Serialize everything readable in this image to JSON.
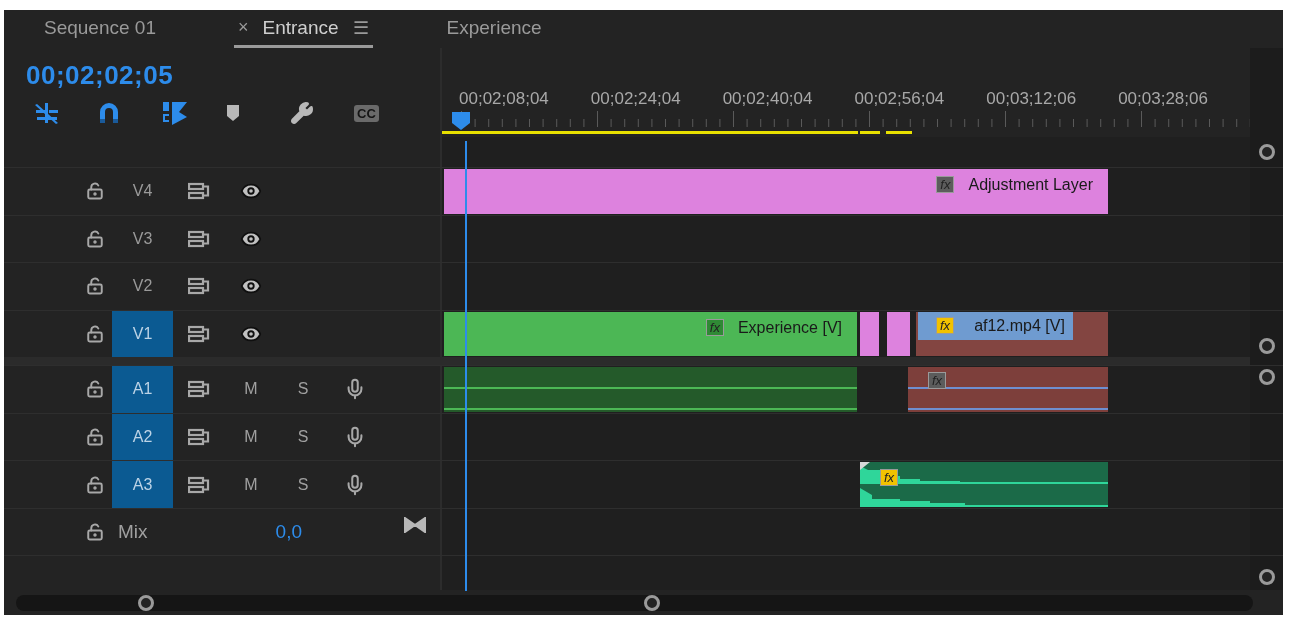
{
  "tabs": [
    {
      "label": "Sequence 01",
      "selected": false
    },
    {
      "label": "Entrance",
      "selected": true,
      "close": "×",
      "menu": "☰"
    },
    {
      "label": "Experience",
      "selected": false
    }
  ],
  "timecode": "00;02;02;05",
  "toolbar": {
    "cc_label": "CC"
  },
  "ruler": {
    "labels": [
      "00;02;08;04",
      "00;02;24;04",
      "00;02;40;04",
      "00;02;56;04",
      "00;03;12;06",
      "00;03;28;06"
    ]
  },
  "tracks": [
    {
      "name": "V4",
      "kind": "video",
      "targeted": false,
      "clips": [
        {
          "kind": "video",
          "label": "Adjustment Layer",
          "color": "#dd82de",
          "fx": {
            "label": "fx",
            "color": "#5c5c5c"
          }
        }
      ]
    },
    {
      "name": "V3",
      "kind": "video",
      "targeted": false
    },
    {
      "name": "V2",
      "kind": "video",
      "targeted": false
    },
    {
      "name": "V1",
      "kind": "video",
      "targeted": true,
      "clips": [
        {
          "kind": "video",
          "label": "Experience [V]",
          "color": "#4cb755",
          "fx": {
            "label": "fx",
            "color": "#2f8a35"
          }
        },
        {
          "kind": "plain",
          "color": "#dd82de"
        },
        {
          "kind": "plain",
          "color": "#dd82de"
        },
        {
          "kind": "header",
          "label": "af12.mp4 [V]",
          "color": "#834541",
          "fx": {
            "label": "fx",
            "color": "#f2c200"
          }
        }
      ]
    },
    {
      "name": "A1",
      "kind": "audio",
      "targeted": true,
      "mute": "M",
      "solo": "S",
      "clips": [
        {
          "kind": "audio",
          "color": "#245a2a"
        },
        {
          "kind": "audio",
          "color": "#7d3f3b",
          "fx": {
            "label": "fx",
            "color": "#5c5c5c"
          }
        }
      ]
    },
    {
      "name": "A2",
      "kind": "audio",
      "targeted": true,
      "mute": "M",
      "solo": "S"
    },
    {
      "name": "A3",
      "kind": "audio",
      "targeted": true,
      "mute": "M",
      "solo": "S",
      "clips": [
        {
          "kind": "waveform",
          "color": "#1b6a48",
          "fx": {
            "label": "fx",
            "color": "#f2c200"
          }
        }
      ]
    }
  ],
  "mix": {
    "label": "Mix",
    "value": "0,0"
  }
}
